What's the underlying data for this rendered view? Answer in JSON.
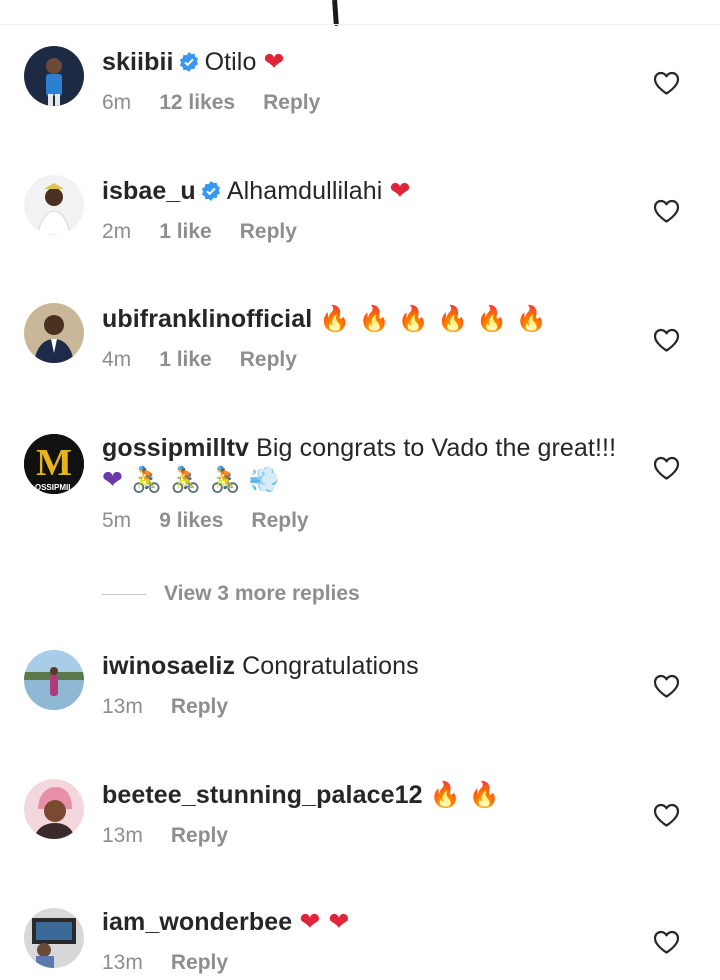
{
  "comments": [
    {
      "username": "skiibii",
      "verified": true,
      "text": "Otilo",
      "emoji": "❤",
      "time": "6m",
      "likes": "12 likes",
      "reply": "Reply"
    },
    {
      "username": "isbae_u",
      "verified": true,
      "text": "Alhamdullilahi",
      "emoji": "❤",
      "time": "2m",
      "likes": "1 like",
      "reply": "Reply"
    },
    {
      "username": "ubifranklinofficial",
      "verified": false,
      "text": "",
      "emoji": "🔥 🔥 🔥 🔥 🔥 🔥",
      "time": "4m",
      "likes": "1 like",
      "reply": "Reply"
    },
    {
      "username": "gossipmilltv",
      "verified": false,
      "text": "Big congrats to Vado the great!!!",
      "emoji": "❤ 🚴 🚴 🚴 💨",
      "time": "5m",
      "likes": "9 likes",
      "reply": "Reply",
      "avatar_letter": "M",
      "avatar_caption": "OSSIPMIL"
    },
    {
      "username": "iwinosaeliz",
      "verified": false,
      "text": "Congratulations",
      "emoji": "",
      "time": "13m",
      "likes": "",
      "reply": "Reply"
    },
    {
      "username": "beetee_stunning_palace12",
      "verified": false,
      "text": "",
      "emoji": "🔥 🔥",
      "time": "13m",
      "likes": "",
      "reply": "Reply"
    },
    {
      "username": "iam_wonderbee",
      "verified": false,
      "text": "",
      "emoji": "❤ ❤",
      "time": "13m",
      "likes": "",
      "reply": "Reply"
    }
  ],
  "view_more_replies": "View 3 more replies",
  "colors": {
    "username": "#262626",
    "meta": "#8e8e8e",
    "verified": "#3897f0",
    "heart_red": "#e0243a"
  },
  "icons": {
    "verified": "verified-badge-icon",
    "like": "heart-outline-icon"
  }
}
